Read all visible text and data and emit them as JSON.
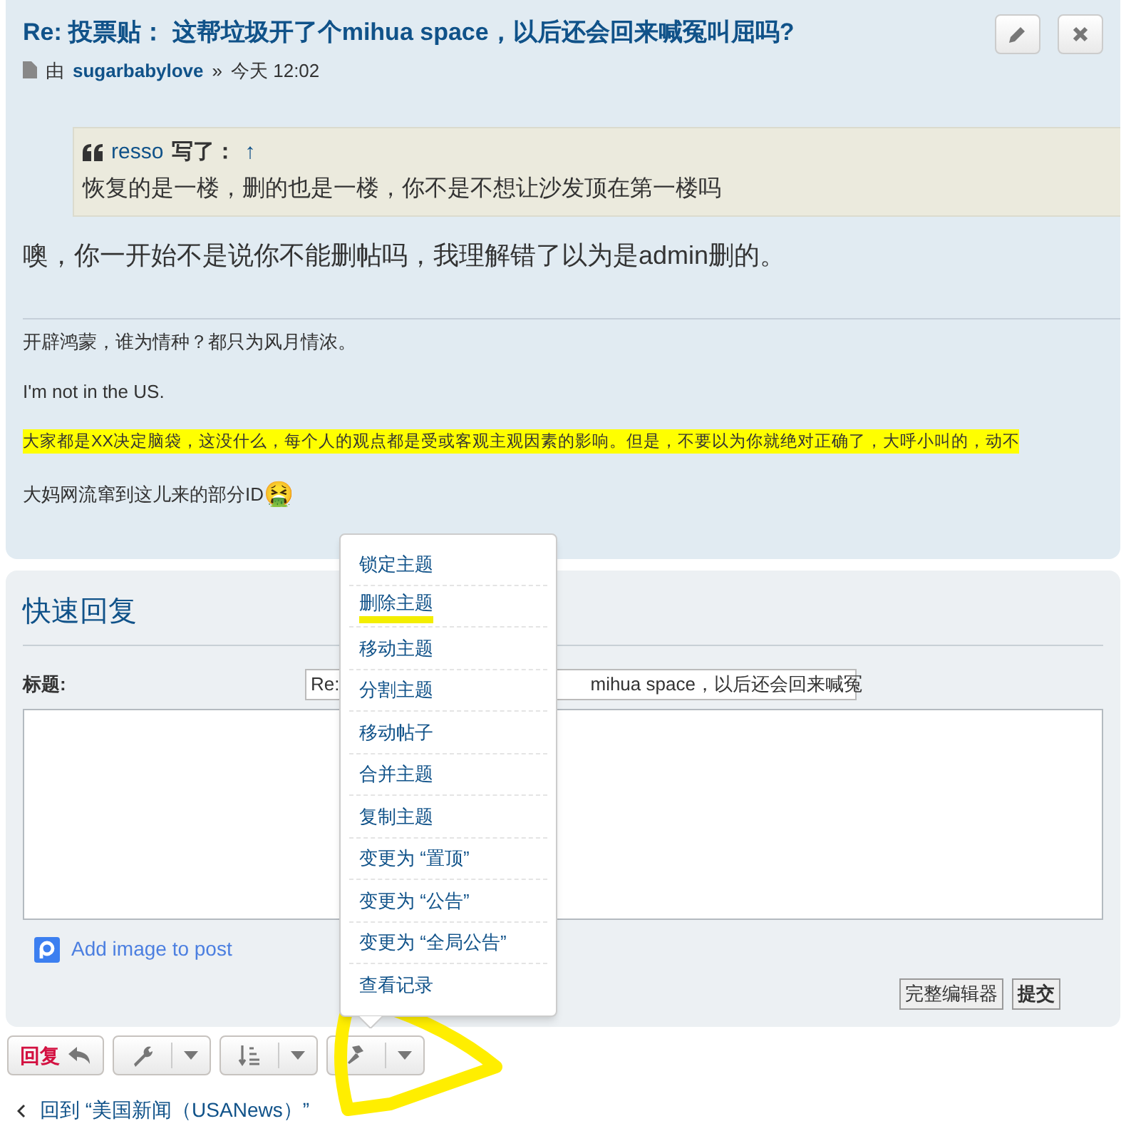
{
  "post": {
    "title": "Re: 投票贴： 这帮垃圾开了个mihua space，以后还会回来喊冤叫屈吗?",
    "by": "由",
    "author": "sugarbabylove",
    "separator": "»",
    "time": "今天 12:02",
    "quote": {
      "author": "resso",
      "wrote": "写了：",
      "up": "↑",
      "text": "恢复的是一楼，删的也是一楼，你不是不想让沙发顶在第一楼吗"
    },
    "body": "噢，你一开始不是说你不能删帖吗，我理解错了以为是admin删的。",
    "signature": [
      {
        "text": "开辟鸿蒙，谁为情种？都只为风月情浓。",
        "highlighted": false
      },
      {
        "text": "I'm not in the US.",
        "highlighted": false
      },
      {
        "text": "大家都是XX决定脑袋，这没什么，每个人的观点都是受或客观主观因素的影响。但是，不要以为你就绝对正确了，大呼小叫的，动不",
        "highlighted": true
      },
      {
        "text": "大妈网流窜到这儿来的部分ID",
        "highlighted": false,
        "emoji": "🤮"
      }
    ]
  },
  "quick_reply": {
    "heading": "快速回复",
    "subject_label": "标题:",
    "subject_value_start": "Re:",
    "subject_value_end": "mihua space，以后还会回来喊冤",
    "add_image": "Add image to post",
    "buttons": [
      "完整编辑器",
      "提交"
    ]
  },
  "actions": {
    "reply": "回复"
  },
  "menu": [
    {
      "label": "锁定主题",
      "marked": false
    },
    {
      "label": "删除主题",
      "marked": true
    },
    {
      "label": "移动主题",
      "marked": false
    },
    {
      "label": "分割主题",
      "marked": false
    },
    {
      "label": "移动帖子",
      "marked": false
    },
    {
      "label": "合并主题",
      "marked": false
    },
    {
      "label": "复制主题",
      "marked": false
    },
    {
      "label": "变更为 “置顶”",
      "marked": false
    },
    {
      "label": "变更为 “公告”",
      "marked": false
    },
    {
      "label": "变更为 “全局公告”",
      "marked": false
    },
    {
      "label": "查看记录",
      "marked": false
    }
  ],
  "back_link": "回到 “美国新闻（USANews）”"
}
